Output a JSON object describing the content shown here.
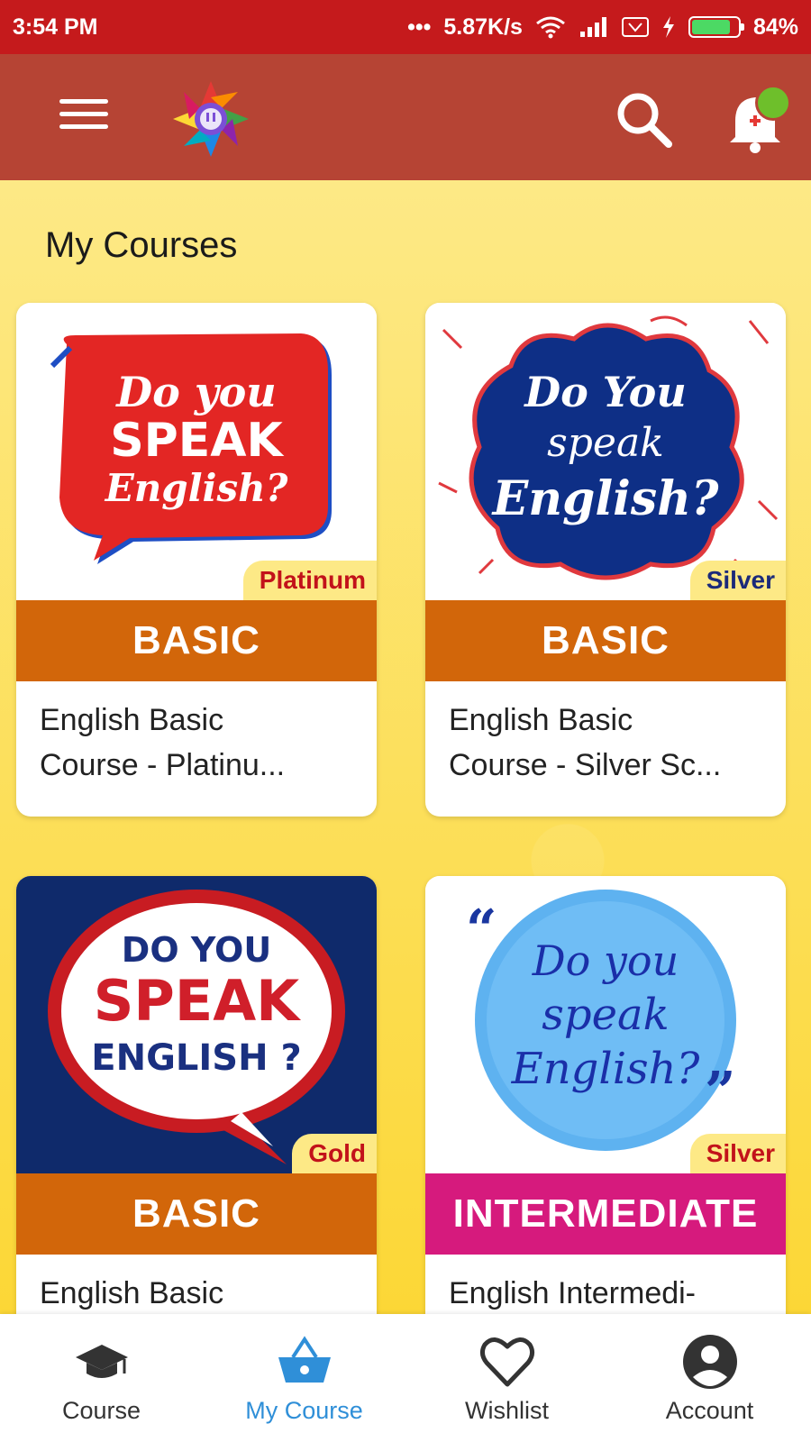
{
  "status_bar": {
    "time": "3:54 PM",
    "net_speed": "5.87K/s",
    "battery": "84%",
    "battery_level": 0.84
  },
  "app_bar": {
    "icons": [
      "menu-icon",
      "app-logo",
      "search-icon",
      "notification-bell-icon"
    ]
  },
  "page": {
    "title": "My Courses"
  },
  "courses": [
    {
      "art_text": [
        "Do you",
        "SPEAK",
        "English?"
      ],
      "badge": "Platinum",
      "badge_color": "#c2121a",
      "level": "BASIC",
      "level_color": "#d2660a",
      "name_line1": "English Basic",
      "name_line2": "Course - Platinu..."
    },
    {
      "art_text": [
        "Do You",
        "speak",
        "English?"
      ],
      "badge": "Silver",
      "badge_color": "#1b2a7a",
      "level": "BASIC",
      "level_color": "#d2660a",
      "name_line1": "English Basic",
      "name_line2": "Course - Silver Sc..."
    },
    {
      "art_text": [
        "DO YOU",
        "SPEAK",
        "ENGLISH ?"
      ],
      "badge": "Gold",
      "badge_color": "#c2121a",
      "level": "BASIC",
      "level_color": "#d2660a",
      "name_line1": "English Basic",
      "name_line2": ""
    },
    {
      "art_text": [
        "Do you",
        "speak",
        "English?"
      ],
      "badge": "Silver",
      "badge_color": "#c2121a",
      "level": "INTERMEDIATE",
      "level_color": "#d61a7d",
      "name_line1": "English Intermedi-",
      "name_line2": ""
    }
  ],
  "bottom_nav": [
    {
      "label": "Course",
      "icon": "graduation-cap-icon",
      "active": false
    },
    {
      "label": "My Course",
      "icon": "shopping-basket-icon",
      "active": true
    },
    {
      "label": "Wishlist",
      "icon": "heart-icon",
      "active": false
    },
    {
      "label": "Account",
      "icon": "account-circle-icon",
      "active": false
    }
  ]
}
